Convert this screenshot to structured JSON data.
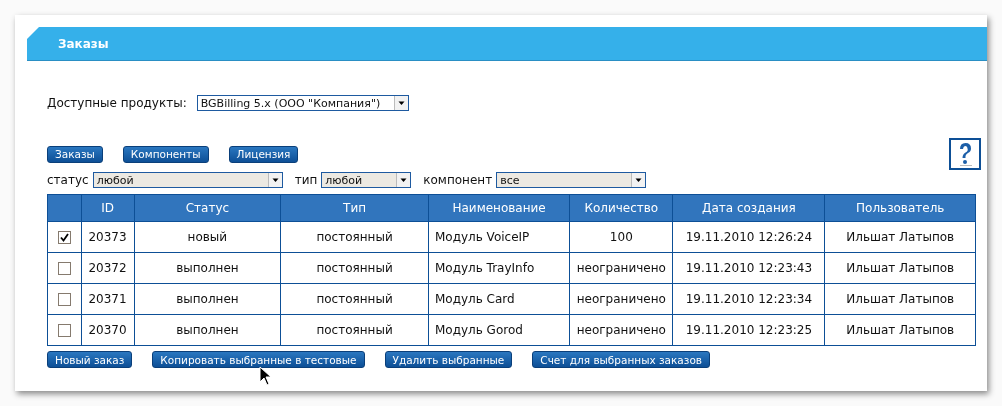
{
  "header": {
    "title": "Заказы"
  },
  "products": {
    "label": "Доступные продукты:",
    "value": "BGBilling 5.x (ООО \"Компания\")"
  },
  "nav_buttons": [
    "Заказы",
    "Компоненты",
    "Лицензия"
  ],
  "filters": [
    {
      "label": "статус",
      "value": "любой"
    },
    {
      "label": "тип",
      "value": "любой"
    },
    {
      "label": "компонент",
      "value": "все"
    }
  ],
  "table": {
    "columns": [
      "ID",
      "Статус",
      "Тип",
      "Наименование",
      "Количество",
      "Дата создания",
      "Пользователь"
    ],
    "rows": [
      {
        "checked": true,
        "cells": [
          "20373",
          "новый",
          "постоянный",
          "Модуль VoiceIP",
          "100",
          "19.11.2010 12:26:24",
          "Ильшат Латыпов"
        ]
      },
      {
        "checked": false,
        "cells": [
          "20372",
          "выполнен",
          "постоянный",
          "Модуль TrayInfo",
          "неограничено",
          "19.11.2010 12:23:43",
          "Ильшат Латыпов"
        ]
      },
      {
        "checked": false,
        "cells": [
          "20371",
          "выполнен",
          "постоянный",
          "Модуль Card",
          "неограничено",
          "19.11.2010 12:23:34",
          "Ильшат Латыпов"
        ]
      },
      {
        "checked": false,
        "cells": [
          "20370",
          "выполнен",
          "постоянный",
          "Модуль Gorod",
          "неограничено",
          "19.11.2010 12:23:25",
          "Ильшат Латыпов"
        ]
      }
    ]
  },
  "action_buttons": [
    "Новый заказ",
    "Копировать выбранные в тестовые",
    "Удалить выбранные",
    "Счет для выбранных заказов"
  ]
}
